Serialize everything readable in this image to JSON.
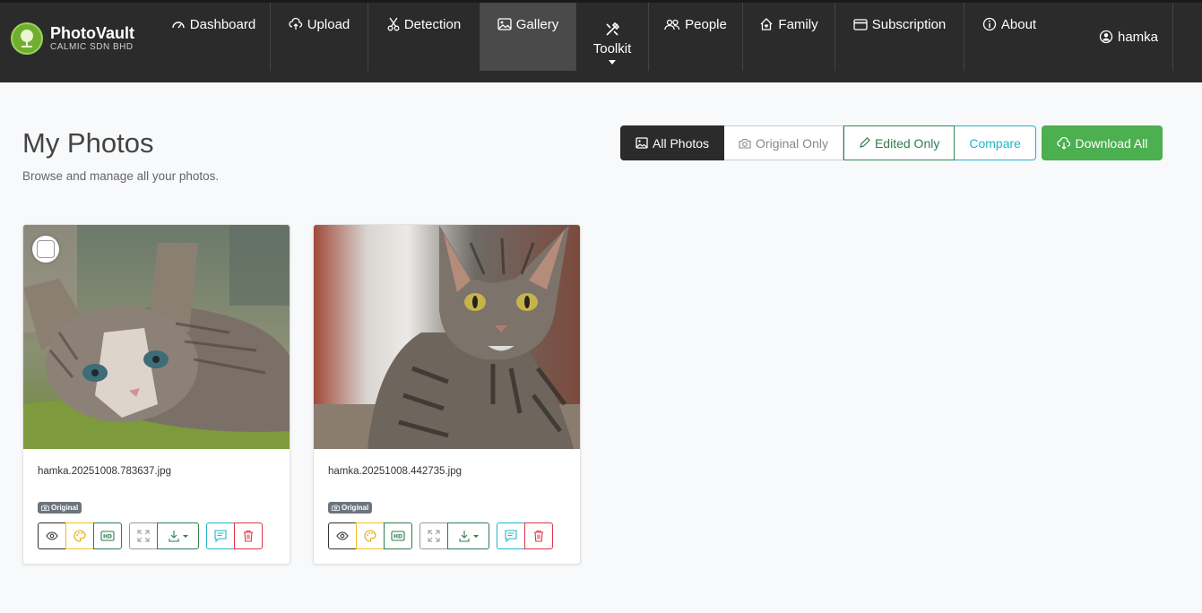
{
  "brand": {
    "name": "PhotoVault",
    "sub": "CALMIC SDN BHD"
  },
  "nav": {
    "dashboard": "Dashboard",
    "upload": "Upload",
    "detection": "Detection",
    "gallery": "Gallery",
    "toolkit": "Toolkit",
    "people": "People",
    "family": "Family",
    "subscription": "Subscription",
    "about": "About",
    "user": "hamka"
  },
  "page": {
    "title": "My Photos",
    "subtitle": "Browse and manage all your photos."
  },
  "filters": {
    "all": "All Photos",
    "original": "Original Only",
    "edited": "Edited Only",
    "compare": "Compare",
    "active": "all"
  },
  "download_all": "Download All",
  "photos": [
    {
      "filename": "hamka.20251008.783637.jpg",
      "badge": "Original"
    },
    {
      "filename": "hamka.20251008.442735.jpg",
      "badge": "Original"
    }
  ],
  "colors": {
    "navbar": "#2b2b2b",
    "accent_green": "#4caf50",
    "teal": "#1fb6c9",
    "danger": "#dc3545",
    "warning": "#f0c020"
  }
}
